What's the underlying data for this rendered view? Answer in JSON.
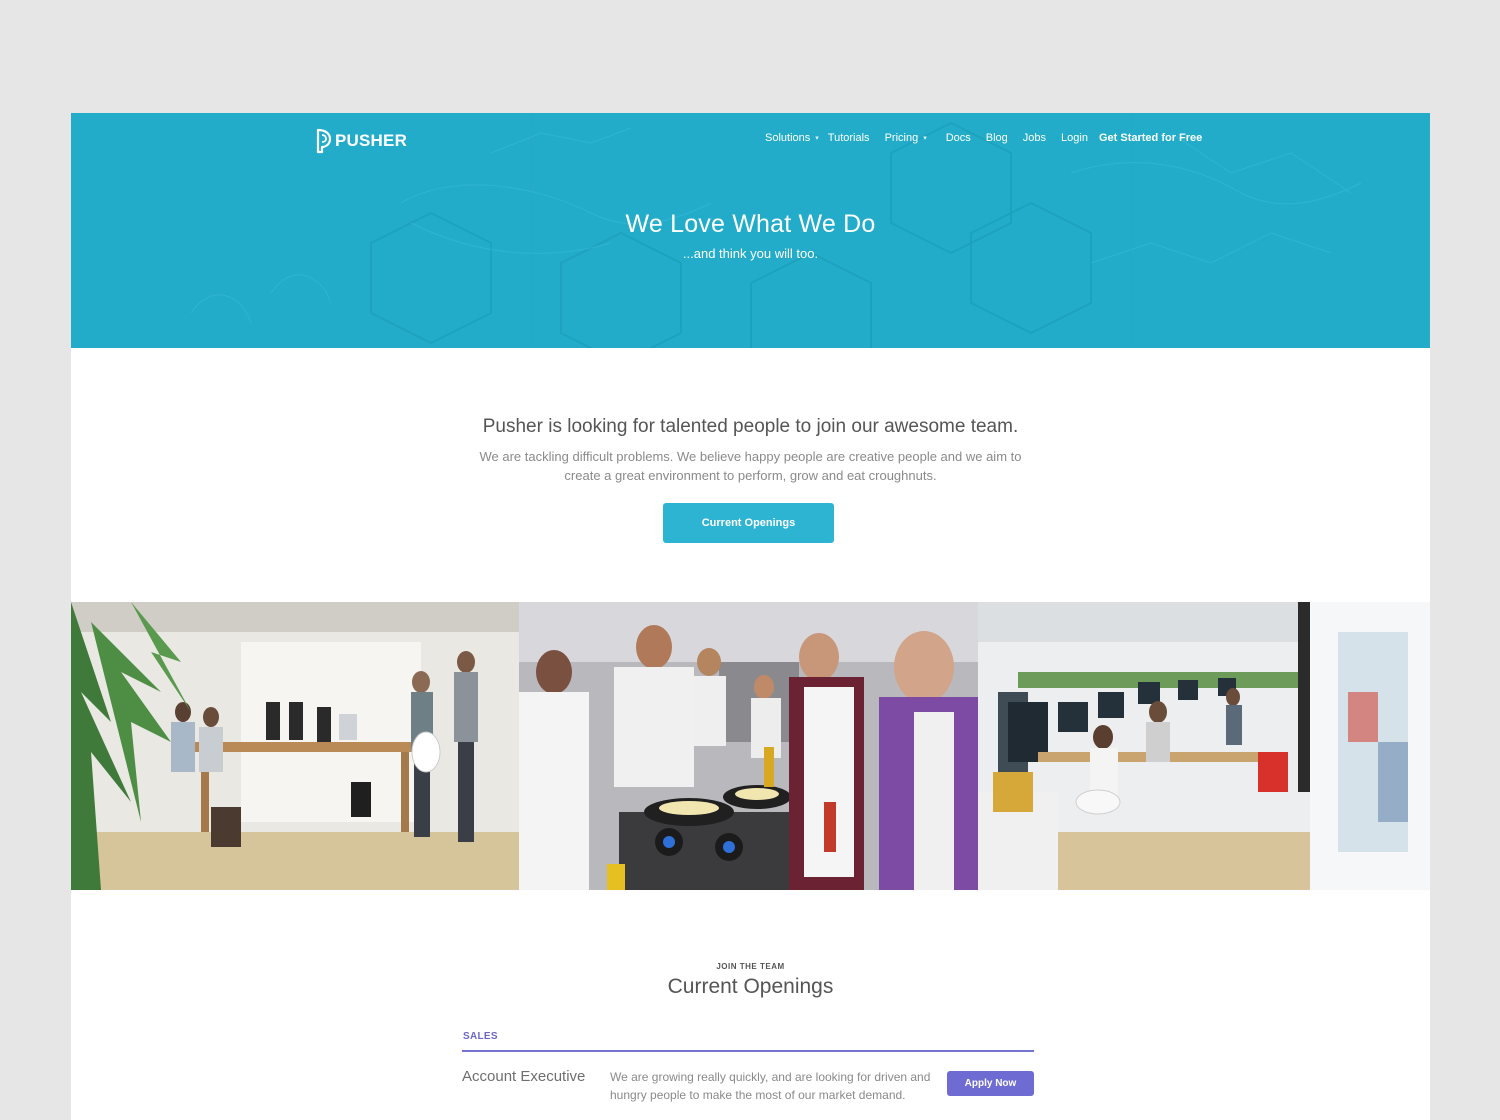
{
  "brand": {
    "name": "PUSHER"
  },
  "nav": {
    "items": [
      {
        "label": "Solutions",
        "has_caret": true
      },
      {
        "label": "Tutorials",
        "has_caret": false
      },
      {
        "label": "Pricing",
        "has_caret": true
      },
      {
        "label": "Docs",
        "has_caret": false
      },
      {
        "label": "Blog",
        "has_caret": false
      },
      {
        "label": "Jobs",
        "has_caret": false
      },
      {
        "label": "Login",
        "has_caret": false
      }
    ],
    "cta": "Get Started for Free"
  },
  "hero": {
    "title": "We Love What We Do",
    "subtitle": "...and think you will too."
  },
  "intro": {
    "heading": "Pusher is looking for talented people to join our awesome team.",
    "body": "We are tackling difficult problems. We believe happy people are creative people and we aim to create a great environment to perform, grow and eat croughnuts.",
    "button": "Current Openings"
  },
  "photos": [
    {
      "subject": "office-meeting-photo"
    },
    {
      "subject": "team-cooking-photo"
    },
    {
      "subject": "open-plan-office-photo"
    }
  ],
  "openings": {
    "eyebrow": "JOIN THE TEAM",
    "title": "Current Openings",
    "departments": [
      {
        "name": "SALES",
        "jobs": [
          {
            "title": "Account Executive",
            "description": "We are growing really quickly, and are looking for driven and hungry people to make the most of our market demand.",
            "button": "Apply Now"
          }
        ]
      }
    ]
  },
  "colors": {
    "hero_bg": "#22acc9",
    "primary_button": "#2eb4d3",
    "accent_purple": "#6e6bd3",
    "page_bg": "#e6e6e6"
  }
}
